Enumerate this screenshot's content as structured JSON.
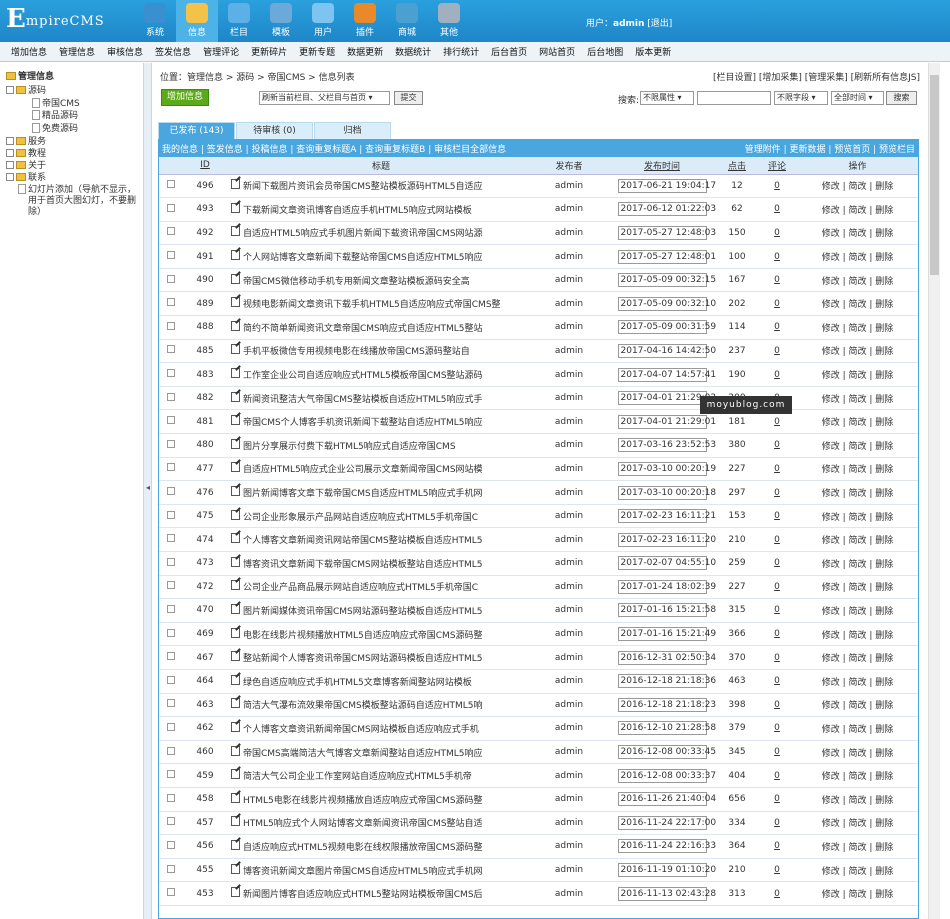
{
  "app": {
    "logo_big": "E",
    "logo_rest": "mpireCMS"
  },
  "topnav": [
    {
      "label": "系统",
      "icon": "globe-icon",
      "color": "#3a8fd0"
    },
    {
      "label": "信息",
      "icon": "pencil-icon",
      "color": "#f2c24a"
    },
    {
      "label": "栏目",
      "icon": "folder-icon",
      "color": "#5bb0e8"
    },
    {
      "label": "模板",
      "icon": "template-icon",
      "color": "#6aa9d8"
    },
    {
      "label": "用户",
      "icon": "user-icon",
      "color": "#7ec4f0"
    },
    {
      "label": "插件",
      "icon": "tools-icon",
      "color": "#e88a2a"
    },
    {
      "label": "商城",
      "icon": "shop-icon",
      "color": "#4aa0d0"
    },
    {
      "label": "其他",
      "icon": "gear-icon",
      "color": "#a0b0c0"
    }
  ],
  "user": {
    "prefix": "用户：",
    "name": "admin",
    "logout": "[退出]"
  },
  "menu": [
    "增加信息",
    "管理信息",
    "审核信息",
    "签发信息",
    "管理评论",
    "更新碎片",
    "更新专题",
    "数据更新",
    "数据统计",
    "排行统计",
    "后台首页",
    "网站首页",
    "后台地图",
    "版本更新"
  ],
  "sidebar": {
    "title": "管理信息",
    "items": [
      "源码",
      "帝国CMS",
      "精品源码",
      "免费源码",
      "服务",
      "教程",
      "关于",
      "联系",
      "幻灯片添加（导航不显示，",
      "用于首页大图幻灯，不要删",
      "除）"
    ]
  },
  "position": {
    "label": "位置：",
    "path": "管理信息 > 源码 > 帝国CMS > 信息列表",
    "links": "[栏目设置] [增加采集] [管理采集] [刷新所有信息JS]"
  },
  "toolbar": {
    "add_label": "增加信息",
    "refresh_select": "刷新当前栏目、父栏目与首页",
    "submit_label": "提交",
    "search_label": "搜索:",
    "attr_select": "不限属性",
    "search_value": "",
    "field_select": "不限字段",
    "time_select": "全部时间",
    "search_button": "搜索"
  },
  "tabs": [
    "已发布 (143)",
    "待审核 (0)",
    "归档"
  ],
  "linkbar": {
    "left": "我的信息 | 签发信息 | 投稿信息 | 查询重复标题A | 查询重复标题B | 审核栏目全部信息",
    "right": "管理附件 | 更新数据 | 预览首页 | 预览栏目"
  },
  "columns": [
    "ID",
    "标题",
    "发布者",
    "发布时间",
    "点击",
    "评论",
    "操作"
  ],
  "ops": "修改 | 简改 | 删除",
  "rows": [
    {
      "id": "496",
      "title": "新闻下载图片资讯会员帝国CMS整站模板源码HTML5自适应",
      "pub": "admin",
      "time": "2017-06-21 19:04:17",
      "click": "12",
      "com": "0"
    },
    {
      "id": "493",
      "title": "下载新闻文章资讯博客自适应手机HTML5响应式网站模板",
      "pub": "admin",
      "time": "2017-06-12 01:22:03",
      "click": "62",
      "com": "0"
    },
    {
      "id": "492",
      "title": "自适应HTML5响应式手机图片新闻下载资讯帝国CMS网站源",
      "pub": "admin",
      "time": "2017-05-27 12:48:03",
      "click": "150",
      "com": "0"
    },
    {
      "id": "491",
      "title": "个人网站博客文章新闻下载整站帝国CMS自适应HTML5响应",
      "pub": "admin",
      "time": "2017-05-27 12:48:01",
      "click": "100",
      "com": "0"
    },
    {
      "id": "490",
      "title": "帝国CMS微信移动手机专用新闻文章整站模板源码安全高",
      "pub": "admin",
      "time": "2017-05-09 00:32:15",
      "click": "167",
      "com": "0"
    },
    {
      "id": "489",
      "title": "视频电影新闻文章资讯下载手机HTML5自适应响应式帝国CMS整",
      "pub": "admin",
      "time": "2017-05-09 00:32:10",
      "click": "202",
      "com": "0"
    },
    {
      "id": "488",
      "title": "简约不简单新闻资讯文章帝国CMS响应式自适应HTML5整站",
      "pub": "admin",
      "time": "2017-05-09 00:31:59",
      "click": "114",
      "com": "0"
    },
    {
      "id": "485",
      "title": "手机平板微信专用视频电影在线播放帝国CMS源码整站自",
      "pub": "admin",
      "time": "2017-04-16 14:42:50",
      "click": "237",
      "com": "0"
    },
    {
      "id": "483",
      "title": "工作室企业公司自适应响应式HTML5模板帝国CMS整站源码",
      "pub": "admin",
      "time": "2017-04-07 14:57:41",
      "click": "190",
      "com": "0"
    },
    {
      "id": "482",
      "title": "新闻资讯整洁大气帝国CMS整站模板自适应HTML5响应式手",
      "pub": "admin",
      "time": "2017-04-01 21:29:02",
      "click": "200",
      "com": "0"
    },
    {
      "id": "481",
      "title": "帝国CMS个人博客手机资讯新闻下载整站自适应HTML5响应",
      "pub": "admin",
      "time": "2017-04-01 21:29:01",
      "click": "181",
      "com": "0"
    },
    {
      "id": "480",
      "title": "图片分享展示付费下载HTML5响应式自适应帝国CMS",
      "pub": "admin",
      "time": "2017-03-16 23:52:53",
      "click": "380",
      "com": "0"
    },
    {
      "id": "477",
      "title": "自适应HTML5响应式企业公司展示文章新闻帝国CMS网站模",
      "pub": "admin",
      "time": "2017-03-10 00:20:19",
      "click": "227",
      "com": "0"
    },
    {
      "id": "476",
      "title": "图片新闻博客文章下载帝国CMS自适应HTML5响应式手机网",
      "pub": "admin",
      "time": "2017-03-10 00:20:18",
      "click": "297",
      "com": "0"
    },
    {
      "id": "475",
      "title": "公司企业形象展示产品网站自适应响应式HTML5手机帝国C",
      "pub": "admin",
      "time": "2017-02-23 16:11:21",
      "click": "153",
      "com": "0"
    },
    {
      "id": "474",
      "title": "个人博客文章新闻资讯网站帝国CMS整站模板自适应HTML5",
      "pub": "admin",
      "time": "2017-02-23 16:11:20",
      "click": "210",
      "com": "0"
    },
    {
      "id": "473",
      "title": "博客资讯文章新闻下载帝国CMS网站模板整站自适应HTML5",
      "pub": "admin",
      "time": "2017-02-07 04:55:10",
      "click": "259",
      "com": "0"
    },
    {
      "id": "472",
      "title": "公司企业产品商品展示网站自适应响应式HTML5手机帝国C",
      "pub": "admin",
      "time": "2017-01-24 18:02:39",
      "click": "227",
      "com": "0"
    },
    {
      "id": "470",
      "title": "图片新闻媒体资讯帝国CMS网站源码整站模板自适应HTML5",
      "pub": "admin",
      "time": "2017-01-16 15:21:58",
      "click": "315",
      "com": "0"
    },
    {
      "id": "469",
      "title": "电影在线影片视频播放HTML5自适应响应式帝国CMS源码整",
      "pub": "admin",
      "time": "2017-01-16 15:21:49",
      "click": "366",
      "com": "0"
    },
    {
      "id": "467",
      "title": "整站新闻个人博客资讯帝国CMS网站源码模板自适应HTML5",
      "pub": "admin",
      "time": "2016-12-31 02:50:34",
      "click": "370",
      "com": "0"
    },
    {
      "id": "464",
      "title": "绿色自适应响应式手机HTML5文章博客新闻整站网站模板",
      "pub": "admin",
      "time": "2016-12-18 21:18:36",
      "click": "463",
      "com": "0"
    },
    {
      "id": "463",
      "title": "简洁大气瀑布流效果帝国CMS模板整站源码自适应HTML5响",
      "pub": "admin",
      "time": "2016-12-18 21:18:23",
      "click": "398",
      "com": "0"
    },
    {
      "id": "462",
      "title": "个人博客文章资讯新闻帝国CMS网站模板自适应响应式手机",
      "pub": "admin",
      "time": "2016-12-10 21:28:58",
      "click": "379",
      "com": "0"
    },
    {
      "id": "460",
      "title": "帝国CMS高端简洁大气博客文章新闻整站自适应HTML5响应",
      "pub": "admin",
      "time": "2016-12-08 00:33:45",
      "click": "345",
      "com": "0"
    },
    {
      "id": "459",
      "title": "简洁大气公司企业工作室网站自适应响应式HTML5手机帝",
      "pub": "admin",
      "time": "2016-12-08 00:33:37",
      "click": "404",
      "com": "0"
    },
    {
      "id": "458",
      "title": "HTML5电影在线影片视频播放自适应响应式帝国CMS源码整",
      "pub": "admin",
      "time": "2016-11-26 21:40:04",
      "click": "656",
      "com": "0"
    },
    {
      "id": "457",
      "title": "HTML5响应式个人网站博客文章新闻资讯帝国CMS整站自适",
      "pub": "admin",
      "time": "2016-11-24 22:17:00",
      "click": "334",
      "com": "0"
    },
    {
      "id": "456",
      "title": "自适应响应式HTML5视频电影在线权限播放帝国CMS源码整",
      "pub": "admin",
      "time": "2016-11-24 22:16:33",
      "click": "364",
      "com": "0"
    },
    {
      "id": "455",
      "title": "博客资讯新闻文章图片帝国CMS自适应HTML5响应式手机网",
      "pub": "admin",
      "time": "2016-11-19 01:10:20",
      "click": "210",
      "com": "0"
    },
    {
      "id": "453",
      "title": "新闻图片博客自适应响应式HTML5整站网站模板帝国CMS后",
      "pub": "admin",
      "time": "2016-11-13 02:43:28",
      "click": "313",
      "com": "0"
    }
  ],
  "watermark": "moyublog.com"
}
